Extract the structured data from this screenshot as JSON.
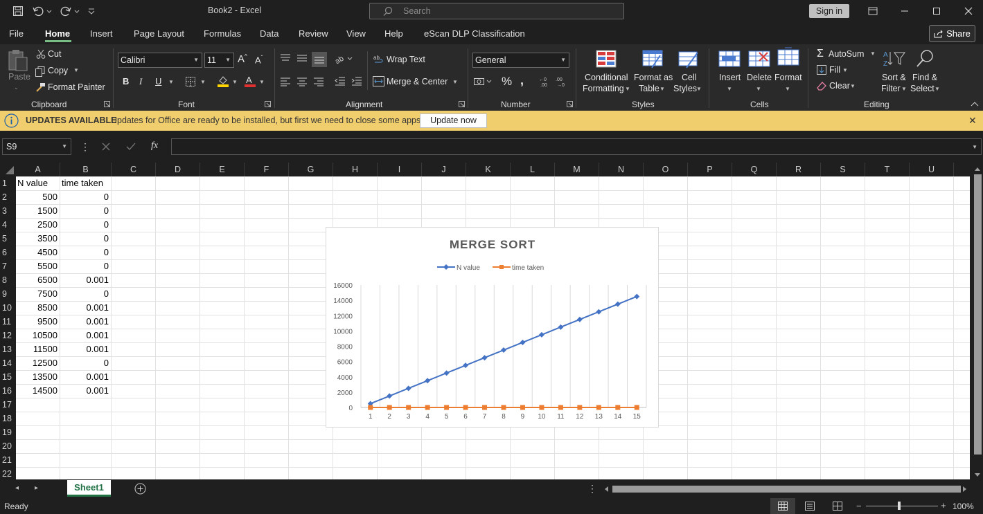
{
  "title": {
    "doc": "Book2  -  Excel",
    "search_placeholder": "Search",
    "signin": "Sign in"
  },
  "menu": {
    "file": "File",
    "home": "Home",
    "insert": "Insert",
    "page_layout": "Page Layout",
    "formulas": "Formulas",
    "data": "Data",
    "review": "Review",
    "view": "View",
    "help": "Help",
    "escan": "eScan DLP Classification",
    "share": "Share"
  },
  "ribbon": {
    "clipboard": {
      "label": "Clipboard",
      "paste": "Paste",
      "cut": "Cut",
      "copy": "Copy",
      "format_painter": "Format Painter"
    },
    "font": {
      "label": "Font",
      "name": "Calibri",
      "size": "11"
    },
    "alignment": {
      "label": "Alignment",
      "wrap_text": "Wrap Text",
      "merge_center": "Merge & Center"
    },
    "number": {
      "label": "Number",
      "format": "General"
    },
    "styles": {
      "label": "Styles",
      "cond1": "Conditional",
      "cond2": "Formatting",
      "fat1": "Format as",
      "fat2": "Table",
      "cell1": "Cell",
      "cell2": "Styles"
    },
    "cells": {
      "label": "Cells",
      "insert": "Insert",
      "delete": "Delete",
      "format": "Format"
    },
    "editing": {
      "label": "Editing",
      "autosum": "AutoSum",
      "fill": "Fill",
      "clear": "Clear",
      "sort1": "Sort &",
      "sort2": "Filter",
      "find1": "Find &",
      "find2": "Select"
    }
  },
  "updates": {
    "title": "UPDATES AVAILABLE",
    "message": "Updates for Office are ready to be installed, but first we need to close some apps.",
    "button": "Update now"
  },
  "formula_bar": {
    "name_box": "S9",
    "formula": ""
  },
  "columns": [
    "A",
    "B",
    "C",
    "D",
    "E",
    "F",
    "G",
    "H",
    "I",
    "J",
    "K",
    "L",
    "M",
    "N",
    "O",
    "P",
    "Q",
    "R",
    "S",
    "T",
    "U"
  ],
  "rows": [
    "1",
    "2",
    "3",
    "4",
    "5",
    "6",
    "7",
    "8",
    "9",
    "10",
    "11",
    "12",
    "13",
    "14",
    "15",
    "16",
    "17",
    "18",
    "19",
    "20",
    "21",
    "22"
  ],
  "cells": {
    "headers": [
      "N value",
      "time taken"
    ],
    "col_a": [
      "500",
      "1500",
      "2500",
      "3500",
      "4500",
      "5500",
      "6500",
      "7500",
      "8500",
      "9500",
      "10500",
      "11500",
      "12500",
      "13500",
      "14500"
    ],
    "col_b": [
      "0",
      "0",
      "0",
      "0",
      "0",
      "0",
      "0.001",
      "0",
      "0.001",
      "0.001",
      "0.001",
      "0.001",
      "0",
      "0.001",
      "0.001"
    ]
  },
  "chart_data": {
    "type": "line",
    "title": "MERGE SORT",
    "categories": [
      1,
      2,
      3,
      4,
      5,
      6,
      7,
      8,
      9,
      10,
      11,
      12,
      13,
      14,
      15
    ],
    "series": [
      {
        "name": "N value",
        "color": "#4472c4",
        "values": [
          500,
          1500,
          2500,
          3500,
          4500,
          5500,
          6500,
          7500,
          8500,
          9500,
          10500,
          11500,
          12500,
          13500,
          14500
        ]
      },
      {
        "name": "time taken",
        "color": "#ed7d31",
        "values": [
          0,
          0,
          0,
          0,
          0,
          0,
          0.001,
          0,
          0.001,
          0.001,
          0.001,
          0.001,
          0,
          0.001,
          0.001
        ]
      }
    ],
    "ylim": [
      0,
      16000
    ],
    "yticks": [
      0,
      2000,
      4000,
      6000,
      8000,
      10000,
      12000,
      14000,
      16000
    ],
    "legend": "top",
    "grid": "vertical"
  },
  "sheet_tab": "Sheet1",
  "status": {
    "ready": "Ready",
    "zoom": "100%"
  }
}
